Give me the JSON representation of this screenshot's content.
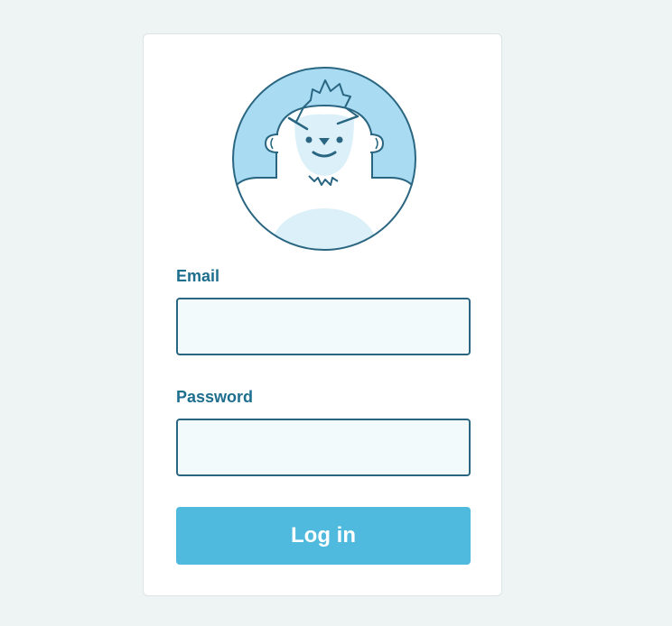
{
  "form": {
    "avatar_icon": "yeti-avatar-icon",
    "email_label": "Email",
    "email_value": "",
    "password_label": "Password",
    "password_value": "",
    "login_label": "Log in"
  },
  "colors": {
    "page_background": "#eef3f4",
    "label_text": "#1e6e8e",
    "input_border": "#2a6681",
    "input_background": "#f3fafc",
    "button_background": "#50b9de",
    "avatar_sky": "#a9dcf3"
  }
}
